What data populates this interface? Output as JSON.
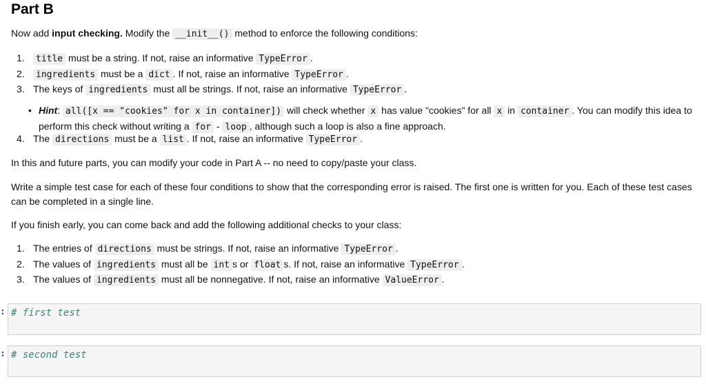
{
  "heading": "Part B",
  "intro": {
    "t1": "Now add ",
    "bold": "input checking.",
    "t2": " Modify the ",
    "code": "__init__()",
    "t3": " method to enforce the following conditions:"
  },
  "conditions": [
    {
      "num": "1.",
      "pre": "",
      "code1": "title",
      "mid": " must be a string. If not, raise an informative ",
      "code2": "TypeError",
      "post": "."
    },
    {
      "num": "2.",
      "pre": "",
      "code1": "ingredients",
      "mid": " must be a ",
      "code_dict": "dict",
      "mid2": ". If not, raise an informative ",
      "code2": "TypeError",
      "post": "."
    },
    {
      "num": "3.",
      "pre": "The keys of ",
      "code1": "ingredients",
      "mid": " must all be strings. If not, raise an informative ",
      "code2": "TypeError",
      "post": "."
    },
    {
      "num": "4.",
      "pre": "The ",
      "code1": "directions",
      "mid": " must be a ",
      "code_list": "list",
      "mid2": ". If not, raise an informative ",
      "code2": "TypeError",
      "post": "."
    }
  ],
  "hint": {
    "label": "Hint",
    "colon": ": ",
    "code1": "all([x == \"cookies\" for x in container])",
    "t1": " will check whether ",
    "code2": "x",
    "t2": " has value \"cookies\" for all ",
    "code3": "x",
    "t3": " in ",
    "code4": "container",
    "t4": ". You can modify this idea to perform this check without writing a ",
    "code5": "for",
    "t5": " - ",
    "code6": "loop",
    "t6": ", although such a loop is also a fine approach."
  },
  "para_partA": "In this and future parts, you can modify your code in Part A -- no need to copy/paste your class.",
  "para_tests": "Write a simple test case for each of these four conditions to show that the corresponding error is raised. The first one is written for you. Each of these test cases can be completed in a single line.",
  "para_extra": "If you finish early, you can come back and add the following additional checks to your class:",
  "extra_checks": [
    {
      "num": "1.",
      "pre": "The entries of ",
      "code1": "directions",
      "mid": " must be strings. If not, raise an informative ",
      "code2": "TypeError",
      "post": "."
    },
    {
      "num": "2.",
      "pre": "The values of ",
      "code1": "ingredients",
      "mid": " must all be ",
      "code_int": "int",
      "mid_s1": "s or ",
      "code_float": "float",
      "mid_s2": "s. If not, raise an informative ",
      "code2": "TypeError",
      "post": "."
    },
    {
      "num": "3.",
      "pre": "The values of ",
      "code1": "ingredients",
      "mid": " must all be nonnegative. If not, raise an informative ",
      "code2": "ValueError",
      "post": "."
    }
  ],
  "cells": [
    {
      "prompt": ":",
      "code": "# first test"
    },
    {
      "prompt": ":",
      "code": "# second test"
    }
  ]
}
